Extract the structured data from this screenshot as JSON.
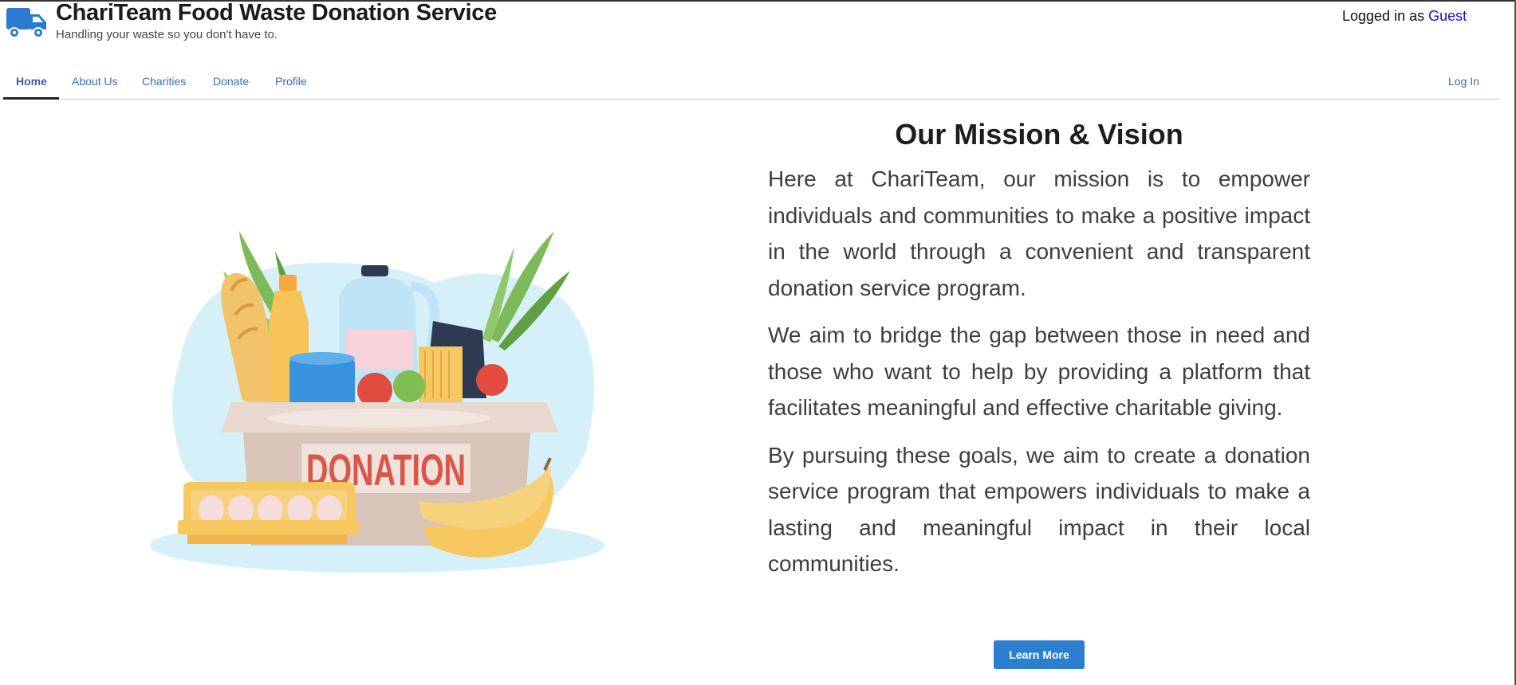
{
  "header": {
    "title": "ChariTeam Food Waste Donation Service",
    "tagline": "Handling your waste so you don't have to.",
    "login_prefix": "Logged in as ",
    "login_user": "Guest",
    "logo_icon": "truck-icon"
  },
  "nav": {
    "items": [
      {
        "label": "Home",
        "active": true
      },
      {
        "label": "About Us"
      },
      {
        "label": "Charities"
      },
      {
        "label": "Donate"
      },
      {
        "label": "Profile"
      }
    ],
    "login_label": "Log In"
  },
  "illustration": {
    "box_label": "DONATION",
    "colors": {
      "blob": "#d6f0f9",
      "box": "#d9c4b9",
      "label": "#d8574a",
      "bread": "#f1c36a",
      "banana": "#f6c85f"
    }
  },
  "mission": {
    "title": "Our Mission & Vision",
    "paragraphs": [
      "Here at ChariTeam, our mission is to empower individuals and communities to make a positive impact in the world through a convenient and transparent donation service program.",
      "We aim to bridge the gap between those in need and those who want to help by providing a platform that facilitates meaningful and effective charitable giving.",
      "By pursuing these goals, we aim to create a donation service program that empowers individuals to make a lasting and meaningful impact in their local communities."
    ],
    "button_label": "Learn More"
  },
  "colors": {
    "accent": "#2c7fd0",
    "nav_link": "#3a6fb8",
    "guest_link": "#1010e0"
  }
}
